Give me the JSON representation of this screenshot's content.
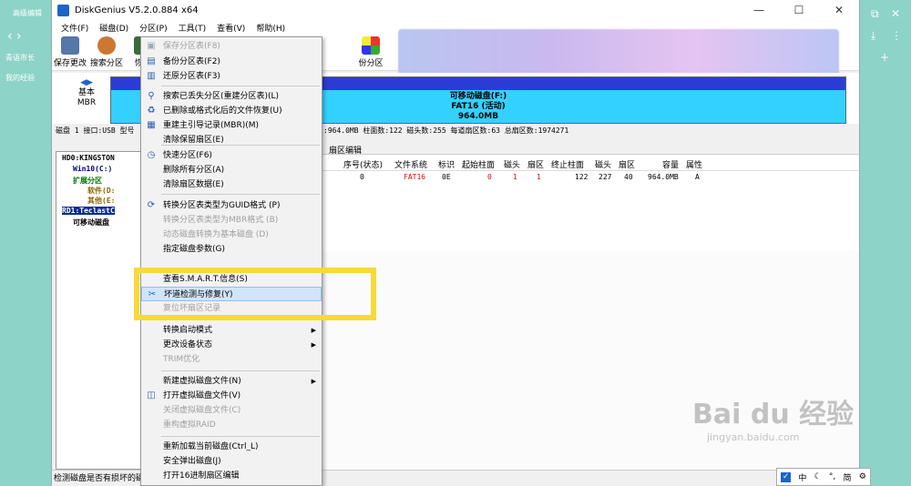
{
  "browser": {
    "tab_left": "高级编辑",
    "row1": "青语市长",
    "row2": "我的经验"
  },
  "window": {
    "title": "DiskGenius V5.2.0.884 x64",
    "minimize": "—",
    "maximize": "☐",
    "close": "✕"
  },
  "menubar": [
    "文件(F)",
    "磁盘(D)",
    "分区(P)",
    "工具(T)",
    "查看(V)",
    "帮助(H)"
  ],
  "toolbar": {
    "save": "保存更改",
    "search": "搜索分区",
    "restore": "恢复",
    "backup": "份分区"
  },
  "disk": {
    "mode_line1": "基本",
    "mode_line2": "MBR",
    "part_title": "可移动磁盘(F:)",
    "part_fs": "FAT16 (活动)",
    "part_size": "964.0MB",
    "info_left": "磁盘 1 接口:USB  型号",
    "info_right": ":964.0MB  柱面数:122  磁头数:255  每道扇区数:63  总扇区数:1974271"
  },
  "tree": {
    "hd0": "HD0:KINGSTON",
    "win10": "Win10(C:)",
    "extended": "扩展分区",
    "software": "软件(D:",
    "other": "其他(E:",
    "rd1": "RD1:TeclastC",
    "removable": "可移动磁盘"
  },
  "tabs": {
    "sector_edit": "扇区编辑"
  },
  "grid": {
    "headers": [
      "序号(状态)",
      "文件系统",
      "标识",
      "起始柱面",
      "磁头",
      "扇区",
      "终止柱面",
      "磁头",
      "扇区",
      "容量",
      "属性"
    ],
    "row": [
      "0",
      "FAT16",
      "0E",
      "0",
      "1",
      "1",
      "122",
      "227",
      "40",
      "964.0MB",
      "A"
    ]
  },
  "statusbar": {
    "text": "检测磁盘是否有损坏的磁"
  },
  "context_menu": [
    {
      "label": "保存分区表(F8)",
      "disabled": true,
      "icon": "save-icon"
    },
    {
      "label": "备份分区表(F2)",
      "disabled": false,
      "icon": "backup-icon"
    },
    {
      "label": "还原分区表(F3)",
      "disabled": false,
      "icon": "restore-icon"
    },
    {
      "label": "搜索已丢失分区(重建分区表)(L)",
      "disabled": false,
      "icon": "search-icon"
    },
    {
      "label": "已删除或格式化后的文件恢复(U)",
      "disabled": false,
      "icon": "recover-icon"
    },
    {
      "label": "重建主引导记录(MBR)(M)",
      "disabled": false,
      "icon": "mbr-icon"
    },
    {
      "label": "清除保留扇区(E)",
      "disabled": false,
      "icon": ""
    },
    {
      "label": "快速分区(F6)",
      "disabled": false,
      "icon": "quick-partition-icon"
    },
    {
      "label": "删除所有分区(A)",
      "disabled": false,
      "icon": ""
    },
    {
      "label": "清除扇区数据(E)",
      "disabled": false,
      "icon": ""
    },
    {
      "label": "转换分区表类型为GUID格式 (P)",
      "disabled": false,
      "icon": "convert-icon"
    },
    {
      "label": "转换分区表类型为MBR格式 (B)",
      "disabled": true,
      "icon": ""
    },
    {
      "label": "动态磁盘转换为基本磁盘 (D)",
      "disabled": true,
      "icon": ""
    },
    {
      "label": "指定磁盘参数(G)",
      "disabled": false,
      "icon": ""
    },
    {
      "label": "查看S.M.A.R.T.信息(S)",
      "disabled": false,
      "icon": ""
    },
    {
      "label": "坏道检测与修复(Y)",
      "disabled": false,
      "icon": "repair-icon",
      "highlight": true
    },
    {
      "label": "复位坏扇区记录",
      "disabled": true,
      "icon": ""
    },
    {
      "label": "转换启动模式",
      "disabled": false,
      "icon": "",
      "submenu": true
    },
    {
      "label": "更改设备状态",
      "disabled": false,
      "icon": "",
      "submenu": true
    },
    {
      "label": "TRIM优化",
      "disabled": true,
      "icon": ""
    },
    {
      "label": "新建虚拟磁盘文件(N)",
      "disabled": false,
      "icon": "",
      "submenu": true
    },
    {
      "label": "打开虚拟磁盘文件(V)",
      "disabled": false,
      "icon": "virtual-disk-icon"
    },
    {
      "label": "关闭虚拟磁盘文件(C)",
      "disabled": true,
      "icon": ""
    },
    {
      "label": "重构虚拟RAID",
      "disabled": true,
      "icon": ""
    },
    {
      "label": "重新加载当前磁盘(Ctrl_L)",
      "disabled": false,
      "icon": ""
    },
    {
      "label": "安全弹出磁盘(J)",
      "disabled": false,
      "icon": ""
    },
    {
      "label": "打开16进制扇区编辑",
      "disabled": false,
      "icon": ""
    }
  ],
  "taskbar": {
    "check": "✓",
    "ime": "中",
    "moon": "☾",
    "punct": "°,",
    "simplified": "简",
    "gear": "⚙"
  },
  "watermark": {
    "main": "Bai du 经验",
    "sub": "jingyan.baidu.com"
  }
}
